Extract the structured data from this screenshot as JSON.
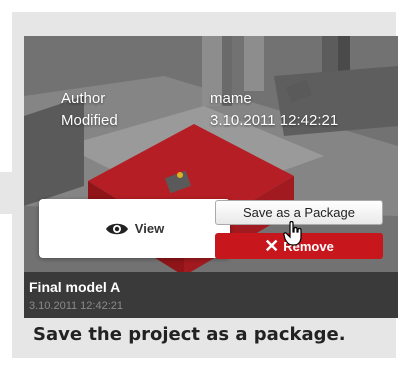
{
  "card": {
    "author_label": "Author",
    "author_value": "mame",
    "modified_label": "Modified",
    "modified_value": "3.10.2011 12:42:21",
    "view_label": "View",
    "save_label": "Save as a Package",
    "remove_label": "Remove",
    "title": "Final model A",
    "date": "3.10.2011 12:42:21"
  },
  "caption": "Save the project as a package.",
  "colors": {
    "panel": "#e6e6e6",
    "remove": "#c8161d",
    "footer": "#3a3a3a",
    "selection_red": "#b41e24"
  },
  "icons": [
    "eye-icon",
    "close-icon",
    "hand-cursor-icon"
  ]
}
